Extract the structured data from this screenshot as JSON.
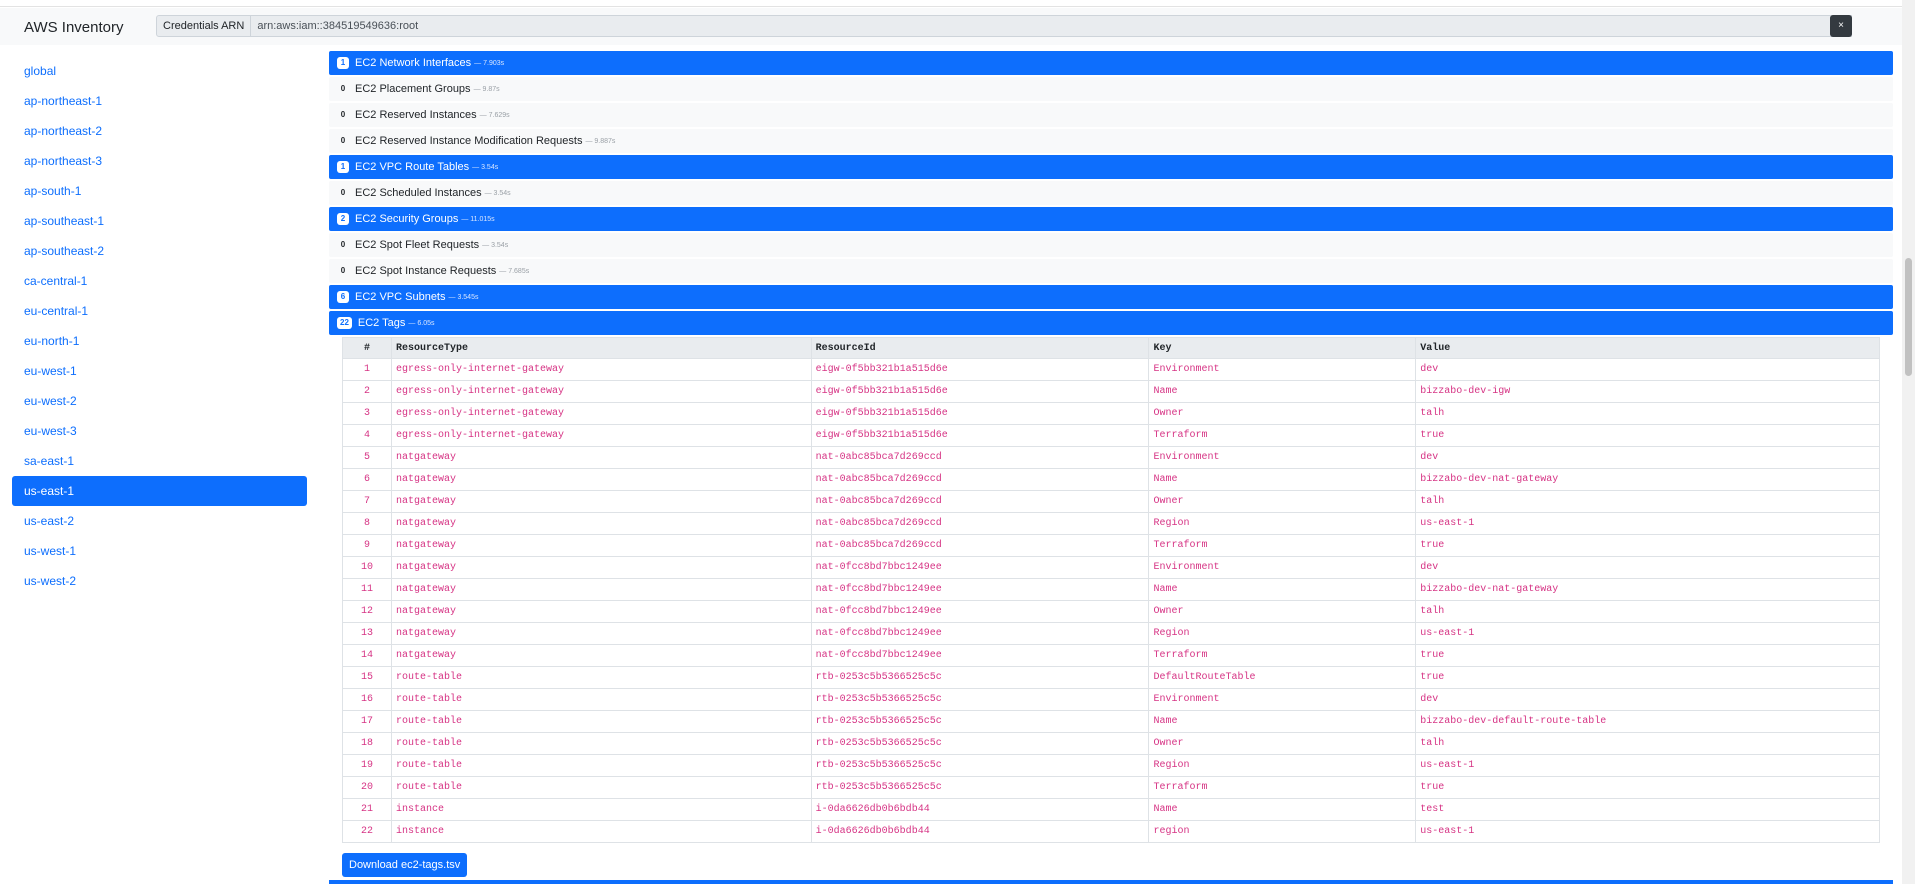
{
  "app": {
    "title": "AWS Inventory"
  },
  "credentials": {
    "label": "Credentials ARN",
    "value": "arn:aws:iam::384519549636:root",
    "clear_label": "×"
  },
  "regions": [
    {
      "label": "global"
    },
    {
      "label": "ap-northeast-1"
    },
    {
      "label": "ap-northeast-2"
    },
    {
      "label": "ap-northeast-3"
    },
    {
      "label": "ap-south-1"
    },
    {
      "label": "ap-southeast-1"
    },
    {
      "label": "ap-southeast-2"
    },
    {
      "label": "ca-central-1"
    },
    {
      "label": "eu-central-1"
    },
    {
      "label": "eu-north-1"
    },
    {
      "label": "eu-west-1"
    },
    {
      "label": "eu-west-2"
    },
    {
      "label": "eu-west-3"
    },
    {
      "label": "sa-east-1"
    },
    {
      "label": "us-east-1",
      "active": true
    },
    {
      "label": "us-east-2"
    },
    {
      "label": "us-west-1"
    },
    {
      "label": "us-west-2"
    }
  ],
  "resources": [
    {
      "count": "1",
      "name": "EC2 Network Interfaces",
      "timing": "— 7.903s",
      "highlight": true
    },
    {
      "count": "0",
      "name": "EC2 Placement Groups",
      "timing": "— 9.87s",
      "highlight": false
    },
    {
      "count": "0",
      "name": "EC2 Reserved Instances",
      "timing": "— 7.629s",
      "highlight": false
    },
    {
      "count": "0",
      "name": "EC2 Reserved Instance Modification Requests",
      "timing": "— 9.887s",
      "highlight": false
    },
    {
      "count": "1",
      "name": "EC2 VPC Route Tables",
      "timing": "— 3.54s",
      "highlight": true
    },
    {
      "count": "0",
      "name": "EC2 Scheduled Instances",
      "timing": "— 3.54s",
      "highlight": false
    },
    {
      "count": "2",
      "name": "EC2 Security Groups",
      "timing": "— 11.015s",
      "highlight": true
    },
    {
      "count": "0",
      "name": "EC2 Spot Fleet Requests",
      "timing": "— 3.54s",
      "highlight": false
    },
    {
      "count": "0",
      "name": "EC2 Spot Instance Requests",
      "timing": "— 7.685s",
      "highlight": false
    },
    {
      "count": "6",
      "name": "EC2 VPC Subnets",
      "timing": "— 3.545s",
      "highlight": true
    },
    {
      "count": "22",
      "name": "EC2 Tags",
      "timing": "— 6.05s",
      "highlight": true
    }
  ],
  "tags_table": {
    "columns": [
      "#",
      "ResourceType",
      "ResourceId",
      "Key",
      "Value"
    ],
    "rows": [
      [
        "1",
        "egress-only-internet-gateway",
        "eigw-0f5bb321b1a515d6e",
        "Environment",
        "dev"
      ],
      [
        "2",
        "egress-only-internet-gateway",
        "eigw-0f5bb321b1a515d6e",
        "Name",
        "bizzabo-dev-igw"
      ],
      [
        "3",
        "egress-only-internet-gateway",
        "eigw-0f5bb321b1a515d6e",
        "Owner",
        "talh"
      ],
      [
        "4",
        "egress-only-internet-gateway",
        "eigw-0f5bb321b1a515d6e",
        "Terraform",
        "true"
      ],
      [
        "5",
        "natgateway",
        "nat-0abc85bca7d269ccd",
        "Environment",
        "dev"
      ],
      [
        "6",
        "natgateway",
        "nat-0abc85bca7d269ccd",
        "Name",
        "bizzabo-dev-nat-gateway"
      ],
      [
        "7",
        "natgateway",
        "nat-0abc85bca7d269ccd",
        "Owner",
        "talh"
      ],
      [
        "8",
        "natgateway",
        "nat-0abc85bca7d269ccd",
        "Region",
        "us-east-1"
      ],
      [
        "9",
        "natgateway",
        "nat-0abc85bca7d269ccd",
        "Terraform",
        "true"
      ],
      [
        "10",
        "natgateway",
        "nat-0fcc8bd7bbc1249ee",
        "Environment",
        "dev"
      ],
      [
        "11",
        "natgateway",
        "nat-0fcc8bd7bbc1249ee",
        "Name",
        "bizzabo-dev-nat-gateway"
      ],
      [
        "12",
        "natgateway",
        "nat-0fcc8bd7bbc1249ee",
        "Owner",
        "talh"
      ],
      [
        "13",
        "natgateway",
        "nat-0fcc8bd7bbc1249ee",
        "Region",
        "us-east-1"
      ],
      [
        "14",
        "natgateway",
        "nat-0fcc8bd7bbc1249ee",
        "Terraform",
        "true"
      ],
      [
        "15",
        "route-table",
        "rtb-0253c5b5366525c5c",
        "DefaultRouteTable",
        "true"
      ],
      [
        "16",
        "route-table",
        "rtb-0253c5b5366525c5c",
        "Environment",
        "dev"
      ],
      [
        "17",
        "route-table",
        "rtb-0253c5b5366525c5c",
        "Name",
        "bizzabo-dev-default-route-table"
      ],
      [
        "18",
        "route-table",
        "rtb-0253c5b5366525c5c",
        "Owner",
        "talh"
      ],
      [
        "19",
        "route-table",
        "rtb-0253c5b5366525c5c",
        "Region",
        "us-east-1"
      ],
      [
        "20",
        "route-table",
        "rtb-0253c5b5366525c5c",
        "Terraform",
        "true"
      ],
      [
        "21",
        "instance",
        "i-0da6626db0b6bdb44",
        "Name",
        "test"
      ],
      [
        "22",
        "instance",
        "i-0da6626db0b6bdb44",
        "region",
        "us-east-1"
      ]
    ]
  },
  "download": {
    "label": "Download ec2-tags.tsv"
  }
}
